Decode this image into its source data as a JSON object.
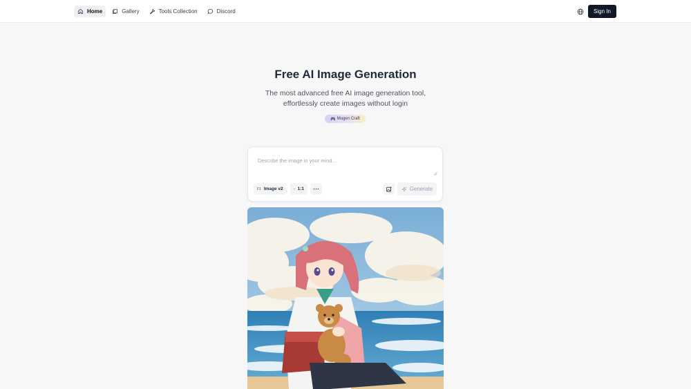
{
  "header": {
    "nav": [
      {
        "label": "Home",
        "icon": "home-icon",
        "active": true
      },
      {
        "label": "Gallery",
        "icon": "gallery-icon",
        "active": false
      },
      {
        "label": "Tools Collection",
        "icon": "wrench-icon",
        "active": false
      },
      {
        "label": "Discord",
        "icon": "chat-bubble-icon",
        "active": false
      }
    ],
    "language_icon": "globe-icon",
    "signin_label": "Sign In"
  },
  "hero": {
    "title": "Free AI Image Generation",
    "subtitle": "The most advanced free AI image generation tool, effortlessly create images without login",
    "badge": "Mugen Craft",
    "badge_icon": "gamepad-emoji"
  },
  "prompt_card": {
    "placeholder": "Describe the image in your mind...",
    "model_prefix": "F1",
    "model_label": "Image v2",
    "ratio_label": "1:1",
    "more_icon": "ellipsis-icon",
    "image_upload_icon": "image-upload-icon",
    "generate_label": "Generate",
    "generate_icon": "sparkle-icon"
  },
  "showcase": {
    "alt": "anime girl with teddy bear at beach"
  },
  "colors": {
    "signin_bg": "#111827",
    "page_bg": "#f7f7f8",
    "badge_start": "#d9d0f5",
    "badge_end": "#f8ecc4"
  }
}
